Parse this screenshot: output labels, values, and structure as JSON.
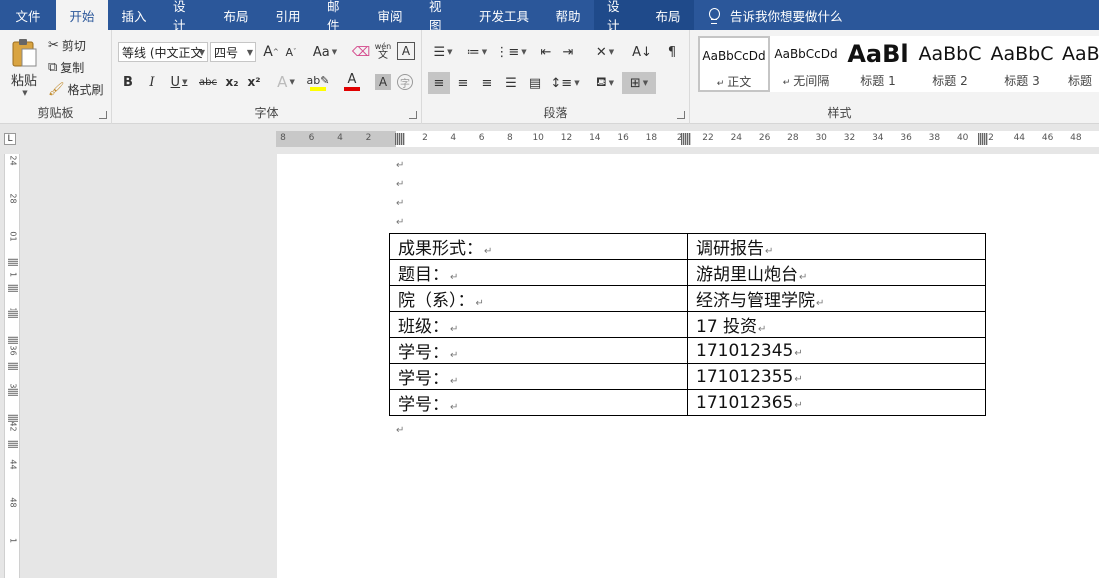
{
  "menu": {
    "tabs": [
      "文件",
      "开始",
      "插入",
      "设计",
      "布局",
      "引用",
      "邮件",
      "审阅",
      "视图",
      "开发工具",
      "帮助"
    ],
    "active_tab": "开始",
    "context_tabs": [
      "设计",
      "布局"
    ],
    "tell_me": "告诉我你想要做什么"
  },
  "ribbon": {
    "clipboard": {
      "label": "剪贴板",
      "paste": "粘贴",
      "cut": "剪切",
      "copy": "复制",
      "format_painter": "格式刷"
    },
    "font": {
      "label": "字体",
      "font_name": "等线 (中文正文",
      "font_size": "四号",
      "grow": "A",
      "shrink": "A",
      "case": "Aa",
      "phonetic": "wén",
      "bold": "B",
      "italic": "I",
      "underline": "U",
      "strike": "abc",
      "sub": "x₂",
      "sup": "x²",
      "color": "A",
      "shade": "A",
      "colors": {
        "highlight": "#ffff00",
        "font_color": "#e00000"
      }
    },
    "paragraph": {
      "label": "段落"
    },
    "styles": {
      "label": "样式",
      "items": [
        {
          "preview": "AaBbCcDd",
          "name": "正文"
        },
        {
          "preview": "AaBbCcDd",
          "name": "无间隔"
        },
        {
          "preview": "AaBl",
          "name": "标题 1"
        },
        {
          "preview": "AaBbC",
          "name": "标题 2"
        },
        {
          "preview": "AaBbC",
          "name": "标题 3"
        },
        {
          "preview": "AaBl",
          "name": "标题"
        }
      ]
    }
  },
  "ruler": {
    "corner": "L",
    "h_left_ticks": [
      "8",
      "6",
      "4",
      "2"
    ],
    "h_ticks": [
      "2",
      "4",
      "6",
      "8",
      "10",
      "12",
      "14",
      "16",
      "18",
      "2",
      "22",
      "24",
      "26",
      "28",
      "30",
      "32",
      "34",
      "36",
      "38",
      "40",
      "2",
      "44",
      "46",
      "48"
    ],
    "v_ticks": [
      "24",
      "28",
      "01",
      "1",
      "13",
      "36",
      "38",
      "42",
      "44",
      "48",
      "1"
    ]
  },
  "document": {
    "paragraph_mark": "↵",
    "table": [
      [
        "成果形式：",
        "调研报告"
      ],
      [
        "题目：",
        "游胡里山炮台"
      ],
      [
        "院（系）：",
        "经济与管理学院"
      ],
      [
        "班级：",
        "17 投资"
      ],
      [
        "学号：",
        "171012345"
      ],
      [
        "学号：",
        "171012355"
      ],
      [
        "学号：",
        "171012365"
      ]
    ]
  }
}
